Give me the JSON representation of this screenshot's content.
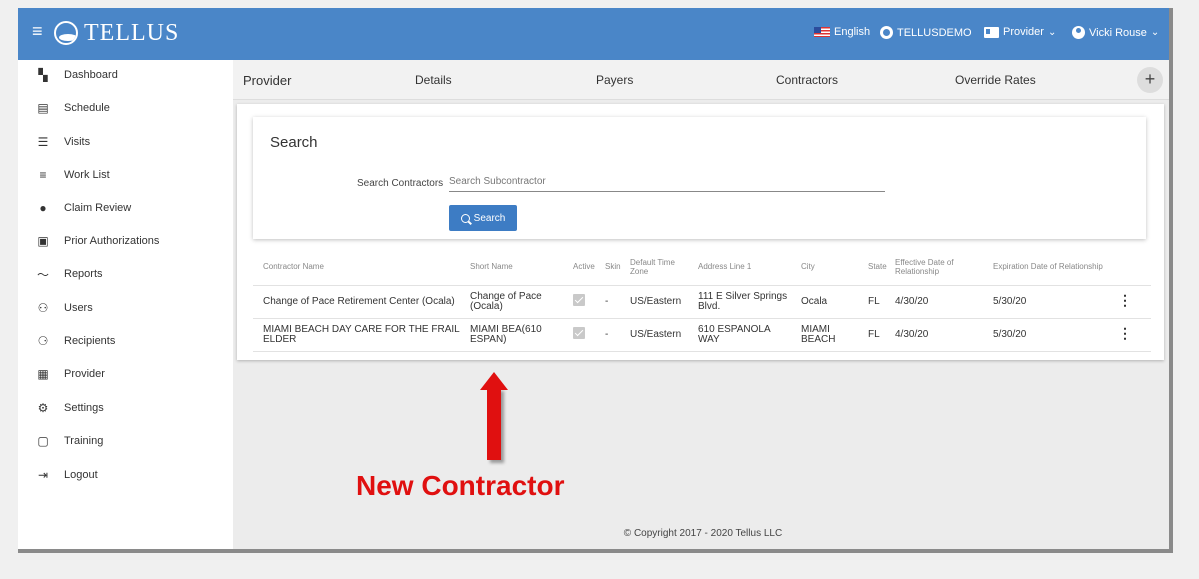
{
  "app": {
    "name": "TELLUS"
  },
  "topbar": {
    "language": "English",
    "org": "TELLUSDEMO",
    "role": "Provider",
    "user": "Vicki Rouse"
  },
  "sidebar": {
    "items": [
      {
        "label": "Dashboard",
        "icon": "dashboard-icon"
      },
      {
        "label": "Schedule",
        "icon": "calendar-icon"
      },
      {
        "label": "Visits",
        "icon": "filter-icon"
      },
      {
        "label": "Work List",
        "icon": "list-icon"
      },
      {
        "label": "Claim Review",
        "icon": "alert-icon"
      },
      {
        "label": "Prior Authorizations",
        "icon": "calendar-icon"
      },
      {
        "label": "Reports",
        "icon": "trend-icon"
      },
      {
        "label": "Users",
        "icon": "users-icon"
      },
      {
        "label": "Recipients",
        "icon": "people-icon"
      },
      {
        "label": "Provider",
        "icon": "clipboard-icon"
      },
      {
        "label": "Settings",
        "icon": "gear-icon"
      },
      {
        "label": "Training",
        "icon": "training-icon"
      },
      {
        "label": "Logout",
        "icon": "logout-icon"
      }
    ]
  },
  "tabs": {
    "title": "Provider",
    "items": [
      "Details",
      "Payers",
      "Contractors",
      "Override Rates"
    ]
  },
  "search": {
    "title": "Search",
    "label": "Search Contractors",
    "placeholder": "Search Subcontractor",
    "button": "Search"
  },
  "table": {
    "columns": [
      "Contractor Name",
      "Short Name",
      "Active",
      "Skin",
      "Default Time Zone",
      "Address Line 1",
      "City",
      "State",
      "Effective Date of Relationship",
      "Expiration Date of Relationship"
    ],
    "rows": [
      {
        "name": "Change of Pace Retirement Center (Ocala)",
        "short": "Change of Pace (Ocala)",
        "active": true,
        "skin": "-",
        "tz": "US/Eastern",
        "address": "111 E Silver Springs Blvd.",
        "city": "Ocala",
        "state": "FL",
        "effective": "4/30/20",
        "expiration": "5/30/20"
      },
      {
        "name": "MIAMI BEACH DAY CARE FOR THE FRAIL ELDER",
        "short": "MIAMI BEA(610 ESPAN)",
        "active": true,
        "skin": "-",
        "tz": "US/Eastern",
        "address": "610 ESPANOLA WAY",
        "city": "MIAMI BEACH",
        "state": "FL",
        "effective": "4/30/20",
        "expiration": "5/30/20"
      }
    ]
  },
  "footer": "© Copyright 2017 - 2020 Tellus LLC",
  "annotation": {
    "text": "New Contractor",
    "color": "#e01010"
  },
  "colors": {
    "brand": "#4a86c8",
    "button": "#3d7cc4"
  }
}
